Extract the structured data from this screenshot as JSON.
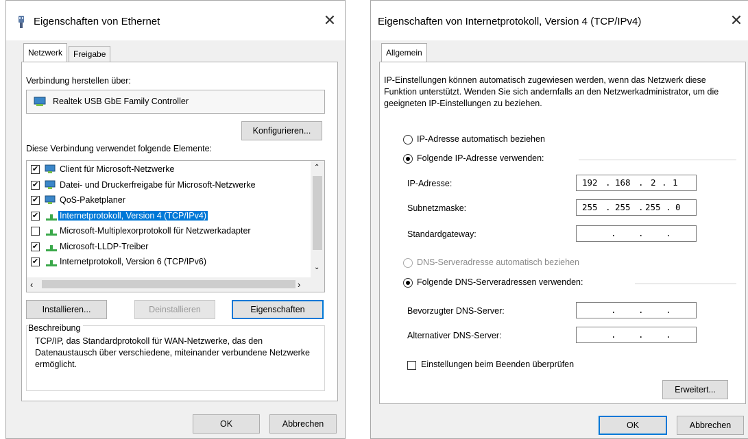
{
  "left": {
    "title": "Eigenschaften von Ethernet",
    "tabs": [
      "Netzwerk",
      "Freigabe"
    ],
    "connect_via_label": "Verbindung herstellen über:",
    "adapter_name": "Realtek USB GbE Family Controller",
    "configure_button": "Konfigurieren...",
    "items_label": "Diese Verbindung verwendet folgende Elemente:",
    "items": [
      {
        "checked": true,
        "label": "Client für Microsoft-Netzwerke",
        "icon": "network-client-icon"
      },
      {
        "checked": true,
        "label": "Datei- und Druckerfreigabe für Microsoft-Netzwerke",
        "icon": "network-share-icon"
      },
      {
        "checked": true,
        "label": "QoS-Paketplaner",
        "icon": "network-service-icon"
      },
      {
        "checked": true,
        "label": "Internetprotokoll, Version 4 (TCP/IPv4)",
        "icon": "protocol-icon",
        "selected": true
      },
      {
        "checked": false,
        "label": "Microsoft-Multiplexorprotokoll für Netzwerkadapter",
        "icon": "protocol-icon"
      },
      {
        "checked": true,
        "label": "Microsoft-LLDP-Treiber",
        "icon": "protocol-icon"
      },
      {
        "checked": true,
        "label": "Internetprotokoll, Version 6 (TCP/IPv6)",
        "icon": "protocol-icon"
      }
    ],
    "install_button": "Installieren...",
    "uninstall_button": "Deinstallieren",
    "properties_button": "Eigenschaften",
    "description_title": "Beschreibung",
    "description_text": "TCP/IP, das Standardprotokoll für WAN-Netzwerke, das den Datenaustausch über verschiedene, miteinander verbundene Netzwerke ermöglicht.",
    "ok_button": "OK",
    "cancel_button": "Abbrechen"
  },
  "right": {
    "title": "Eigenschaften von Internetprotokoll, Version 4 (TCP/IPv4)",
    "tab": "Allgemein",
    "intro_text": "IP-Einstellungen können automatisch zugewiesen werden, wenn das Netzwerk diese Funktion unterstützt. Wenden Sie sich andernfalls an den Netzwerkadministrator, um die geeigneten IP-Einstellungen zu beziehen.",
    "ip_auto_label": "IP-Adresse automatisch beziehen",
    "ip_manual_label": "Folgende IP-Adresse verwenden:",
    "ip_label": "IP-Adresse:",
    "ip_value": [
      "192",
      "168",
      "2",
      "1"
    ],
    "subnet_label": "Subnetzmaske:",
    "subnet_value": [
      "255",
      "255",
      "255",
      "0"
    ],
    "gateway_label": "Standardgateway:",
    "dns_auto_label": "DNS-Serveradresse automatisch beziehen",
    "dns_manual_label": "Folgende DNS-Serveradressen verwenden:",
    "dns_pref_label": "Bevorzugter DNS-Server:",
    "dns_alt_label": "Alternativer DNS-Server:",
    "validate_label": "Einstellungen beim Beenden überprüfen",
    "advanced_button": "Erweitert...",
    "ok_button": "OK",
    "cancel_button": "Abbrechen"
  },
  "colors": {
    "accent": "#0078d7",
    "dialog_bg": "#f0f0f0"
  }
}
